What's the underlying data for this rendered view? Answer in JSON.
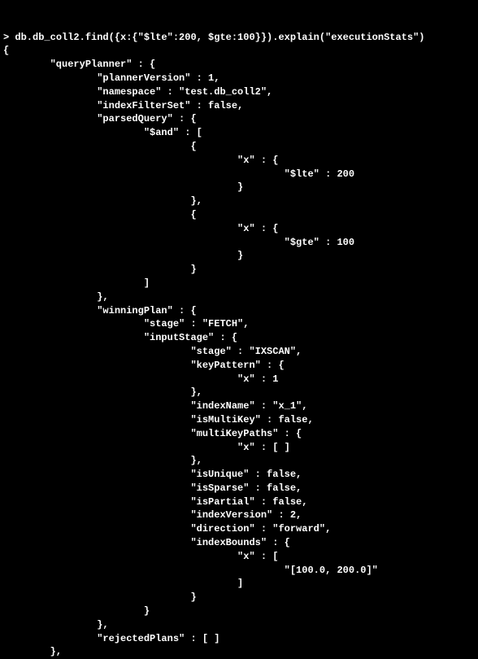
{
  "command_prompt": ">",
  "command": "db.db_coll2.find({x:{\"$lte\":200, $gte:100}}).explain(\"executionStats\")",
  "output_open": "{",
  "qp_header": "\"queryPlanner\" : {",
  "plannerVersion": "\"plannerVersion\" : 1,",
  "namespace": "\"namespace\" : \"test.db_coll2\",",
  "indexFilterSet": "\"indexFilterSet\" : false,",
  "parsedQuery_open": "\"parsedQuery\" : {",
  "and_open": "\"$and\" : [",
  "and0_open": "{",
  "and0_x_open": "\"x\" : {",
  "and0_lte": "\"$lte\" : 200",
  "and0_x_close": "}",
  "and0_close": "},",
  "and1_open": "{",
  "and1_x_open": "\"x\" : {",
  "and1_gte": "\"$gte\" : 100",
  "and1_x_close": "}",
  "and1_close": "}",
  "and_close": "]",
  "parsedQuery_close": "},",
  "winningPlan_open": "\"winningPlan\" : {",
  "wp_stage": "\"stage\" : \"FETCH\",",
  "inputStage_open": "\"inputStage\" : {",
  "is_stage": "\"stage\" : \"IXSCAN\",",
  "keyPattern_open": "\"keyPattern\" : {",
  "keyPattern_x": "\"x\" : 1",
  "keyPattern_close": "},",
  "indexName": "\"indexName\" : \"x_1\",",
  "isMultiKey": "\"isMultiKey\" : false,",
  "multiKeyPaths_open": "\"multiKeyPaths\" : {",
  "multiKeyPaths_x": "\"x\" : [ ]",
  "multiKeyPaths_close": "},",
  "isUnique": "\"isUnique\" : false,",
  "isSparse": "\"isSparse\" : false,",
  "isPartial": "\"isPartial\" : false,",
  "indexVersion": "\"indexVersion\" : 2,",
  "direction": "\"direction\" : \"forward\",",
  "indexBounds_open": "\"indexBounds\" : {",
  "indexBounds_x_open": "\"x\" : [",
  "indexBounds_val": "\"[100.0, 200.0]\"",
  "indexBounds_x_close": "]",
  "indexBounds_close": "}",
  "inputStage_close": "}",
  "winningPlan_close": "},",
  "rejectedPlans": "\"rejectedPlans\" : [ ]",
  "qp_close": "},",
  "chart_data": {
    "type": "table",
    "title": "MongoDB explain executionStats",
    "command": "db.db_coll2.find({x:{\"$lte\":200, $gte:100}}).explain(\"executionStats\")",
    "queryPlanner": {
      "plannerVersion": 1,
      "namespace": "test.db_coll2",
      "indexFilterSet": false,
      "parsedQuery": {
        "$and": [
          {
            "x": {
              "$lte": 200
            }
          },
          {
            "x": {
              "$gte": 100
            }
          }
        ]
      },
      "winningPlan": {
        "stage": "FETCH",
        "inputStage": {
          "stage": "IXSCAN",
          "keyPattern": {
            "x": 1
          },
          "indexName": "x_1",
          "isMultiKey": false,
          "multiKeyPaths": {
            "x": []
          },
          "isUnique": false,
          "isSparse": false,
          "isPartial": false,
          "indexVersion": 2,
          "direction": "forward",
          "indexBounds": {
            "x": [
              "[100.0, 200.0]"
            ]
          }
        }
      },
      "rejectedPlans": []
    }
  }
}
